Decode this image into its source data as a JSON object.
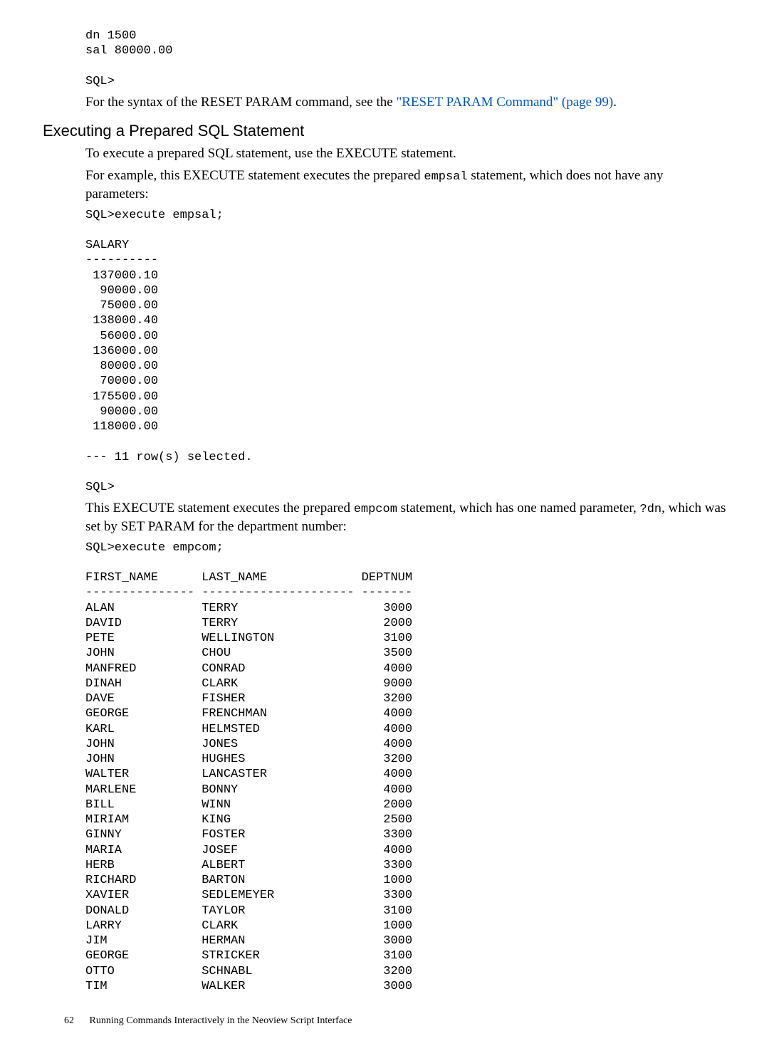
{
  "intro": {
    "code1": "dn 1500\nsal 80000.00\n\nSQL>",
    "line1_a": "For the syntax of the RESET PARAM command, see the ",
    "link_text": "\"RESET PARAM Command\" (page 99)",
    "line1_b": "."
  },
  "heading": "Executing a Prepared SQL Statement",
  "section1": {
    "p1": "To execute a prepared SQL statement, use the EXECUTE statement.",
    "p2_a": "For example, this EXECUTE statement executes the prepared ",
    "p2_code": "empsal",
    "p2_b": " statement, which does not have any parameters:",
    "code": "SQL>execute empsal;\n\nSALARY\n----------\n 137000.10\n  90000.00\n  75000.00\n 138000.40\n  56000.00\n 136000.00\n  80000.00\n  70000.00\n 175500.00\n  90000.00\n 118000.00\n\n--- 11 row(s) selected.\n\nSQL>"
  },
  "section2": {
    "p1_a": "This EXECUTE statement executes the prepared ",
    "p1_code1": "empcom",
    "p1_b": " statement, which has one named parameter, ",
    "p1_code2": "?dn",
    "p1_c": ", which was set by SET PARAM for the department number:",
    "code": "SQL>execute empcom;\n\nFIRST_NAME      LAST_NAME             DEPTNUM\n--------------- --------------------- -------\nALAN            TERRY                    3000\nDAVID           TERRY                    2000\nPETE            WELLINGTON               3100\nJOHN            CHOU                     3500\nMANFRED         CONRAD                   4000\nDINAH           CLARK                    9000\nDAVE            FISHER                   3200\nGEORGE          FRENCHMAN                4000\nKARL            HELMSTED                 4000\nJOHN            JONES                    4000\nJOHN            HUGHES                   3200\nWALTER          LANCASTER                4000\nMARLENE         BONNY                    4000\nBILL            WINN                     2000\nMIRIAM          KING                     2500\nGINNY           FOSTER                   3300\nMARIA           JOSEF                    4000\nHERB            ALBERT                   3300\nRICHARD         BARTON                   1000\nXAVIER          SEDLEMEYER               3300\nDONALD          TAYLOR                   3100\nLARRY           CLARK                    1000\nJIM             HERMAN                   3000\nGEORGE          STRICKER                 3100\nOTTO            SCHNABL                  3200\nTIM             WALKER                   3000"
  },
  "footer": {
    "page": "62",
    "title": "Running Commands Interactively in the Neoview Script Interface"
  }
}
